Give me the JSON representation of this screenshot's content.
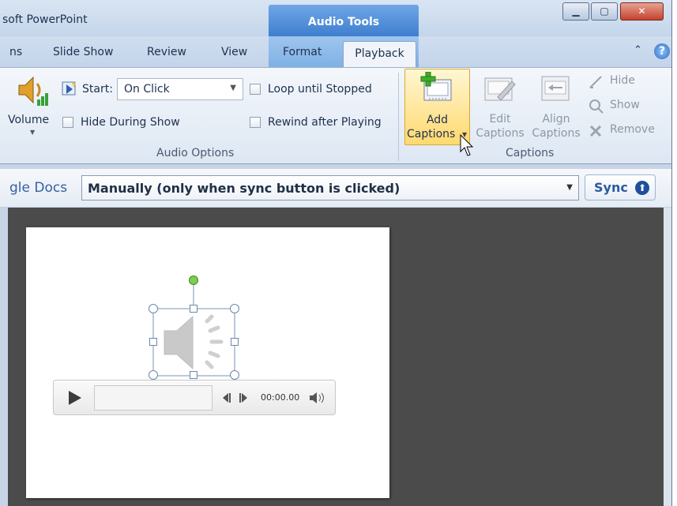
{
  "window": {
    "app_title": "soft PowerPoint",
    "context_tool_title": "Audio Tools",
    "controls": [
      "minimize",
      "maximize",
      "close"
    ]
  },
  "tabs": {
    "partial_left": "ns",
    "slide_show": "Slide Show",
    "review": "Review",
    "view": "View",
    "format": "Format",
    "playback": "Playback",
    "active": "Playback"
  },
  "ribbon": {
    "audio_options": {
      "group_label": "Audio Options",
      "volume_label": "Volume",
      "start_label": "Start:",
      "start_value": "On Click",
      "hide_during_show": "Hide During Show",
      "loop_until_stopped": "Loop until Stopped",
      "rewind_after_playing": "Rewind after Playing"
    },
    "captions": {
      "group_label": "Captions",
      "add_line1": "Add",
      "add_line2": "Captions",
      "edit_line1": "Edit",
      "edit_line2": "Captions",
      "align_line1": "Align",
      "align_line2": "Captions",
      "hide": "Hide",
      "show": "Show",
      "remove": "Remove"
    }
  },
  "docs_bar": {
    "partial_label": "gle Docs",
    "sync_mode": "Manually (only when sync button is clicked)",
    "sync_button": "Sync"
  },
  "player": {
    "time": "00:00.00"
  },
  "colors": {
    "context_tab": "#4f8fdc",
    "highlight_button": "#ffd96e",
    "slide_background": "#ffffff",
    "workspace": "#4b4b4b"
  }
}
